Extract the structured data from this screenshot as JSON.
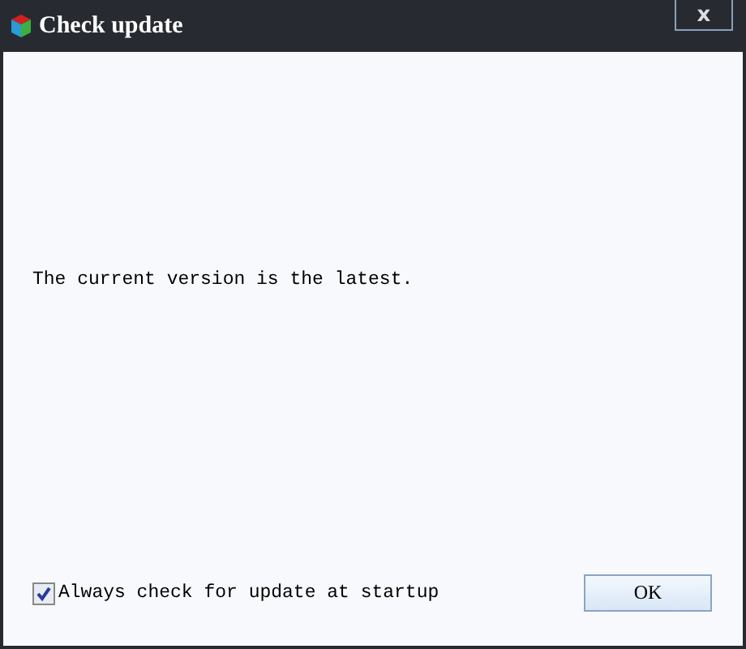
{
  "window": {
    "title": "Check update",
    "close": "x"
  },
  "message": "The current version is the latest.",
  "startup_check": {
    "label": "Always check for update at startup",
    "checked": true
  },
  "buttons": [
    "OK"
  ]
}
